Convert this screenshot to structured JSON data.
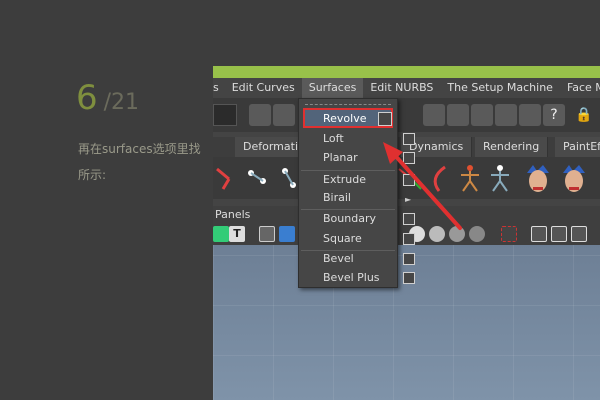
{
  "step": {
    "current": "6",
    "total": "/21"
  },
  "caption": {
    "line1": "再在surfaces选项里找",
    "line2": "所示:"
  },
  "menubar": {
    "items": [
      "s",
      "Edit Curves",
      "Surfaces",
      "Edit NURBS",
      "The Setup Machine",
      "Face Machine"
    ]
  },
  "shelf_tabs": [
    "Deformation",
    "Dynamics",
    "Rendering",
    "PaintEffe"
  ],
  "panels_label": "Panels",
  "surfaces_menu": {
    "items": [
      {
        "label": "Revolve"
      },
      {
        "label": "Loft"
      },
      {
        "label": "Planar"
      },
      {
        "label": "Extrude"
      },
      {
        "label": "Birail"
      },
      {
        "label": "Boundary"
      },
      {
        "label": "Square"
      },
      {
        "label": "Bevel"
      },
      {
        "label": "Bevel Plus"
      }
    ],
    "highlighted": "Revolve",
    "highlight_border_color": "#e03030"
  },
  "colors": {
    "accent_green": "#98c14a",
    "annotation_red": "#e03030",
    "menu_highlight": "#52647a"
  }
}
